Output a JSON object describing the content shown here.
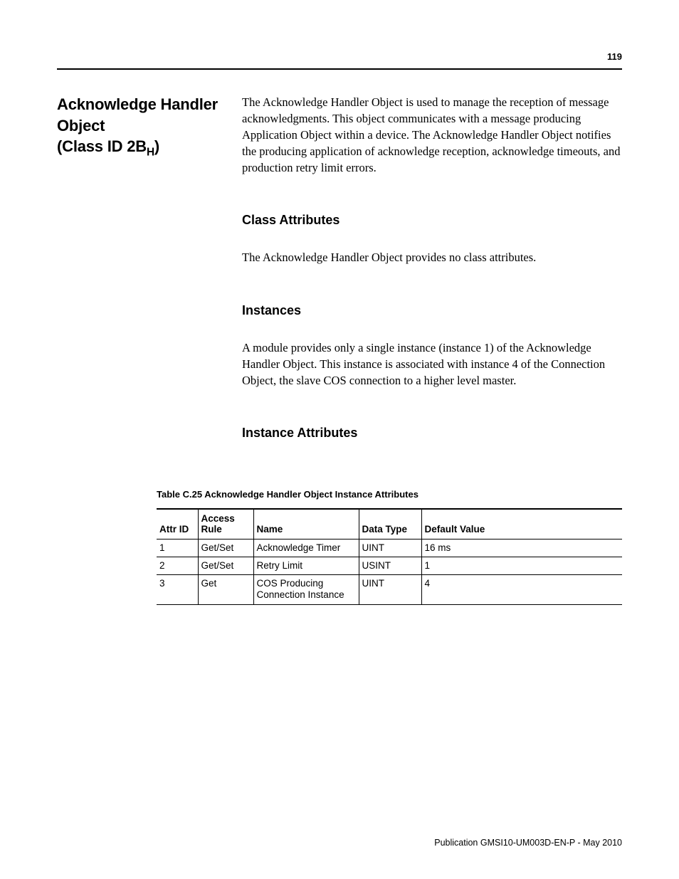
{
  "page_number": "119",
  "sidebar": {
    "title_line1": "Acknowledge Handler",
    "title_line2": "Object",
    "title_line3_pre": "(Class ID 2B",
    "title_line3_sub": "H",
    "title_line3_post": ")"
  },
  "intro": "The Acknowledge Handler Object is used to manage the reception of message acknowledgments. This object communicates with a message producing Application Object within a device. The Acknowledge Handler Object notifies the producing application of acknowledge reception, acknowledge timeouts, and production retry limit errors.",
  "class_attributes": {
    "heading": "Class Attributes",
    "body": "The Acknowledge Handler Object provides no class attributes."
  },
  "instances": {
    "heading": "Instances",
    "body": "A module provides only a single instance (instance 1) of the Acknowledge Handler Object. This instance is associated with instance 4 of the Connection Object, the slave COS connection to a higher level master."
  },
  "instance_attributes": {
    "heading": "Instance Attributes",
    "caption": "Table C.25 Acknowledge Handler Object Instance Attributes",
    "columns": {
      "attr_id": "Attr ID",
      "access_rule_1": "Access",
      "access_rule_2": "Rule",
      "name": "Name",
      "data_type": "Data Type",
      "default_value": "Default Value"
    },
    "rows": [
      {
        "attr_id": "1",
        "access": "Get/Set",
        "name": "Acknowledge Timer",
        "dtype": "UINT",
        "def": "16 ms"
      },
      {
        "attr_id": "2",
        "access": "Get/Set",
        "name": "Retry Limit",
        "dtype": "USINT",
        "def": "1"
      },
      {
        "attr_id": "3",
        "access": "Get",
        "name": "COS Producing Connection Instance",
        "dtype": "UINT",
        "def": "4"
      }
    ]
  },
  "publication": "Publication GMSI10-UM003D-EN-P - May 2010"
}
